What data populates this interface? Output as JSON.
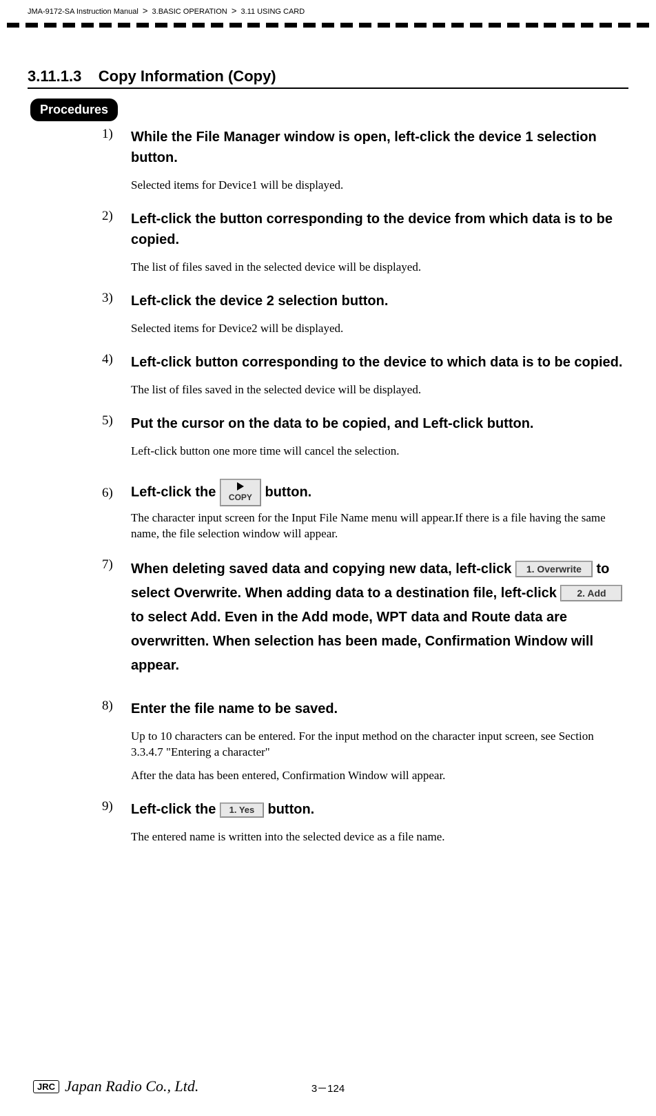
{
  "breadcrumb": {
    "manual": "JMA-9172-SA Instruction Manual",
    "chapter": "3.BASIC OPERATION",
    "section": "3.11  USING CARD"
  },
  "heading": {
    "number": "3.11.1.3",
    "title": "Copy Information (Copy)"
  },
  "badge": "Procedures",
  "steps": [
    {
      "num": "1)",
      "title": "While the File Manager window is open, left-click the device 1 selection button.",
      "body": "Selected items for  Device1  will be displayed."
    },
    {
      "num": "2)",
      "title": "Left-click the button corresponding to the device from which data is to be copied.",
      "body": "The list of files saved in the selected device will be displayed."
    },
    {
      "num": "3)",
      "title": "Left-click the device 2 selection button.",
      "body": "Selected items for  Device2  will be displayed."
    },
    {
      "num": "4)",
      "title": "Left-click button corresponding to the device to which data is to be copied.",
      "body": "The list of files saved in the selected device will be displayed."
    },
    {
      "num": "5)",
      "title": "Put the cursor on the data to be copied, and Left-click button.",
      "body": "Left-click button one more time will cancel the selection."
    },
    {
      "num": "6)",
      "title_pre": "Left-click the ",
      "title_post": " button.",
      "copy_label": "COPY",
      "body": "The character input screen for the Input File Name menu will appear.If there is a file having the same name, the file selection window will appear."
    },
    {
      "num": "7)",
      "t1": "When deleting saved data and copying new data, left-click ",
      "btn_overwrite": "1. Overwrite",
      "t2": " to select Overwrite. When adding data to a destination file, left-click ",
      "btn_add": "2. Add",
      "t3": " to select Add. Even in the Add mode, WPT data and Route data are overwritten. When selection has been made, Confirmation Window will appear."
    },
    {
      "num": "8)",
      "title": "Enter the file name to be saved.",
      "body": "Up to 10 characters can be entered. For the input method on the character input screen, see Section 3.3.4.7 \"Entering a character\"",
      "body2": "After the data has been entered, Confirmation Window will appear."
    },
    {
      "num": "9)",
      "title_pre": "Left-click the ",
      "btn_yes": "1. Yes",
      "title_post": " button.",
      "body": "The entered name is written into the selected device as a file name."
    }
  ],
  "footer": {
    "jrc": "JRC",
    "company": "Japan Radio Co., Ltd.",
    "page": "3－124"
  }
}
